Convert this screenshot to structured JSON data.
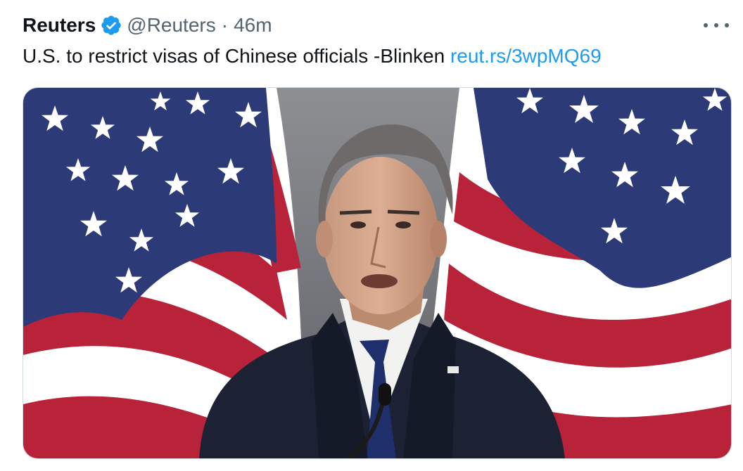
{
  "tweet": {
    "author_name": "Reuters",
    "handle": "@Reuters",
    "separator": "·",
    "time": "46m",
    "text": "U.S. to restrict visas of Chinese officials -Blinken",
    "link": "reut.rs/3wpMQ69"
  },
  "icons": {
    "verified": "verified-badge-icon",
    "more": "more-options-icon"
  },
  "colors": {
    "link": "#1d9bf0",
    "verified": "#1d9bf0",
    "secondary_text": "#536471",
    "flag_blue": "#2d3a78",
    "flag_red": "#b8233a"
  },
  "media": {
    "subject": "man in dark suit speaking at microphone in front of two U.S. flags"
  }
}
